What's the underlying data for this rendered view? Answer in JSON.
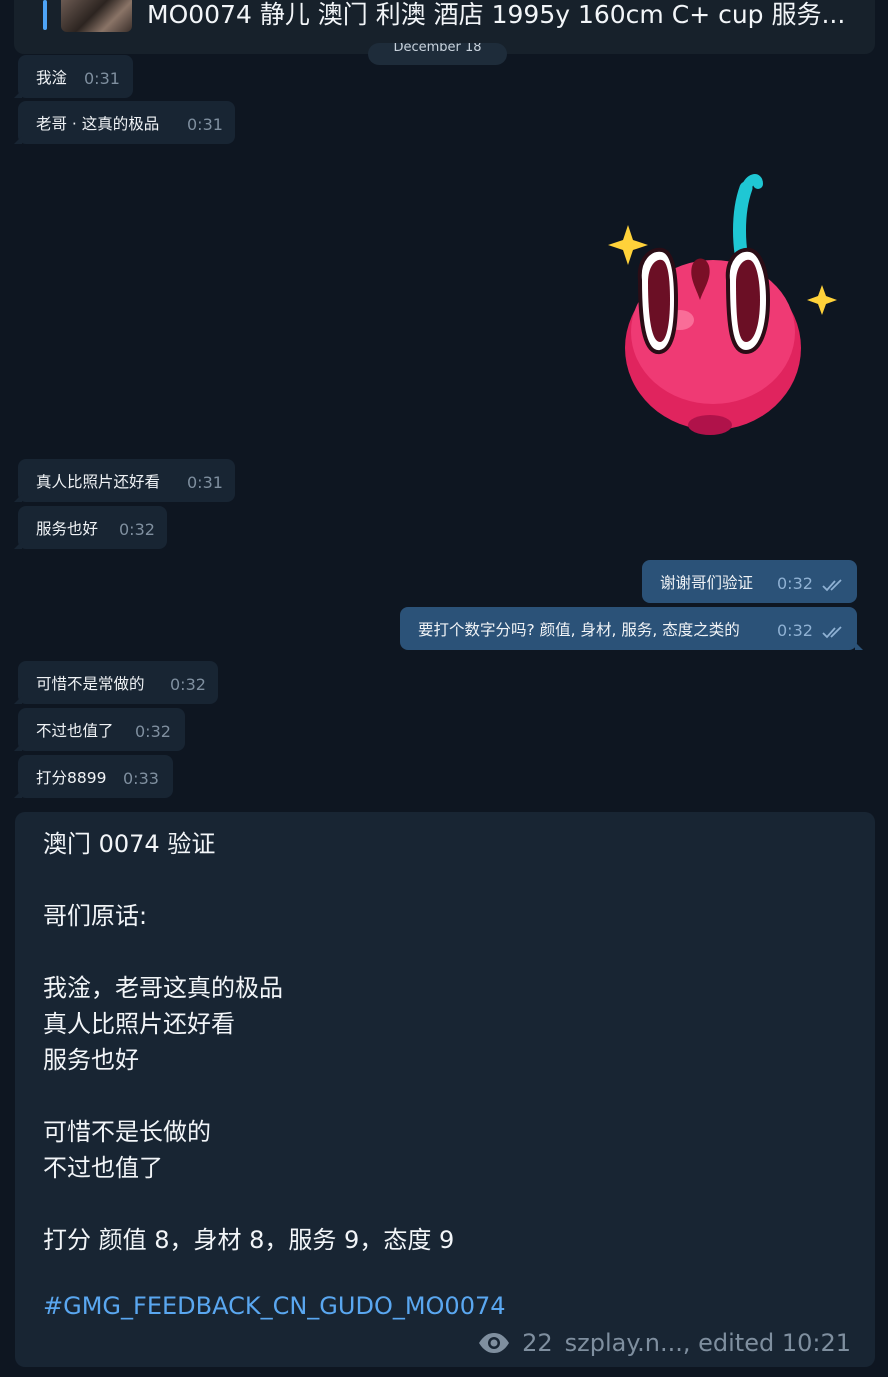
{
  "reply": {
    "title": "MO0074 静儿 澳门 利澳 酒店 1995y  160cm  C+ cup  服务..."
  },
  "date_pill": "December 18",
  "messages": [
    {
      "text": "我淦",
      "time": "0:31"
    },
    {
      "text": "老哥 · 这真的极品",
      "time": "0:31"
    },
    {
      "text": "真人比照片还好看",
      "time": "0:31"
    },
    {
      "text": "服务也好",
      "time": "0:32"
    },
    {
      "text": "谢谢哥们验证",
      "time": "0:32"
    },
    {
      "text": "要打个数字分吗? 颜值, 身材, 服务, 态度之类的",
      "time": "0:32"
    },
    {
      "text": "可惜不是常做的",
      "time": "0:32"
    },
    {
      "text": "不过也值了",
      "time": "0:32"
    },
    {
      "text": "打分8899",
      "time": "0:33"
    }
  ],
  "post": {
    "lines": [
      "澳门 0074 验证",
      "哥们原话:",
      "我淦，老哥这真的极品",
      "真人比照片还好看",
      "服务也好",
      "可惜不是长做的",
      "不过也值了",
      "打分 颜值 8，身材 8，服务 9，态度 9"
    ],
    "hashtag": "#GMG_FEEDBACK_CN_GUDO_MO0074",
    "views": "22",
    "meta": "szplay.n..., edited 10:21"
  },
  "colors": {
    "background": "#0e1621",
    "bubble_in": "#182533",
    "bubble_out": "#2b5278",
    "accent": "#4ea4f6",
    "hashtag": "#5aa7f0"
  }
}
